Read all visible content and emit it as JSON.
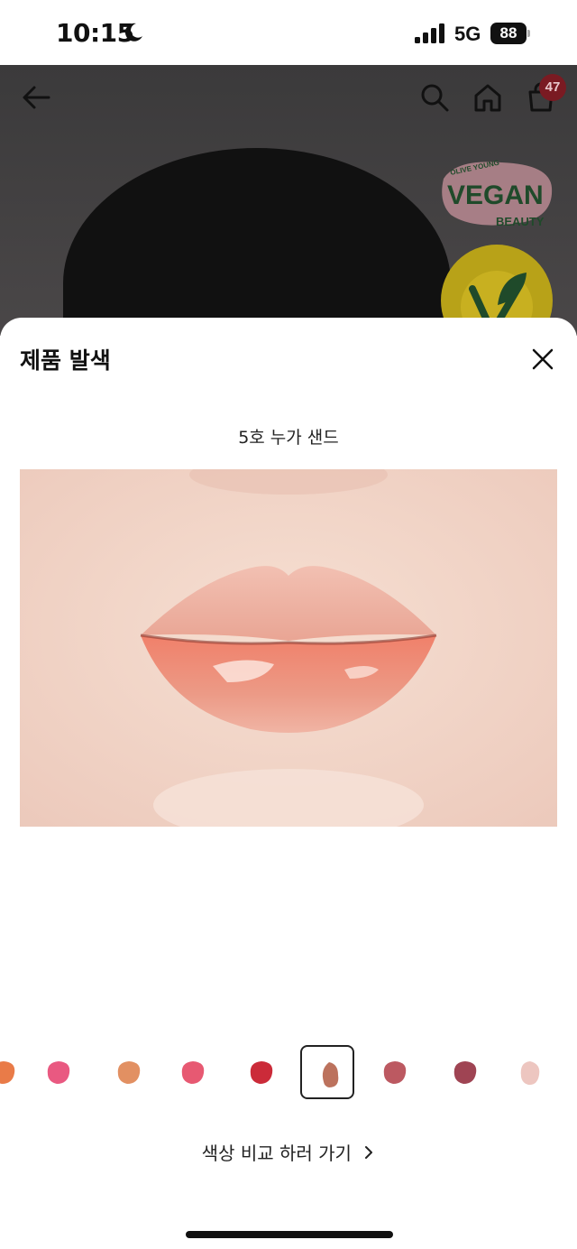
{
  "status_bar": {
    "time": "10:15",
    "network": "5G",
    "battery": "88",
    "icons": [
      "moon-icon",
      "signal-icon",
      "battery-icon"
    ]
  },
  "background_page": {
    "cart_count": "47",
    "icons": [
      "back-arrow-icon",
      "search-icon",
      "home-icon",
      "cart-icon"
    ],
    "vegan_badge": {
      "top": "OLIVE YOUNG",
      "main": "VEGAN",
      "bottom": "BEAUTY"
    },
    "vegetarian_seal": "EUROPEAN VEGETARIAN UNION"
  },
  "sheet": {
    "title": "제품 발색",
    "close_icon": "close-icon",
    "selected_shade": "5호 누가 샌드",
    "compare_link": "색상 비교 하러 가기",
    "swatches": [
      {
        "color": "#e8743e"
      },
      {
        "color": "#e8507a"
      },
      {
        "color": "#e08a5a"
      },
      {
        "color": "#e6506a"
      },
      {
        "color": "#c8202e"
      },
      {
        "color": "#b86a54",
        "selected": true
      },
      {
        "color": "#b85058"
      },
      {
        "color": "#9a3a4a"
      },
      {
        "color": "#e8b8b0"
      }
    ]
  },
  "colors": {
    "overlay": "#3b3a3b",
    "badge": "#7a1a22",
    "vegan_green": "#1f4a2a",
    "seal_yellow": "#d8c020"
  }
}
